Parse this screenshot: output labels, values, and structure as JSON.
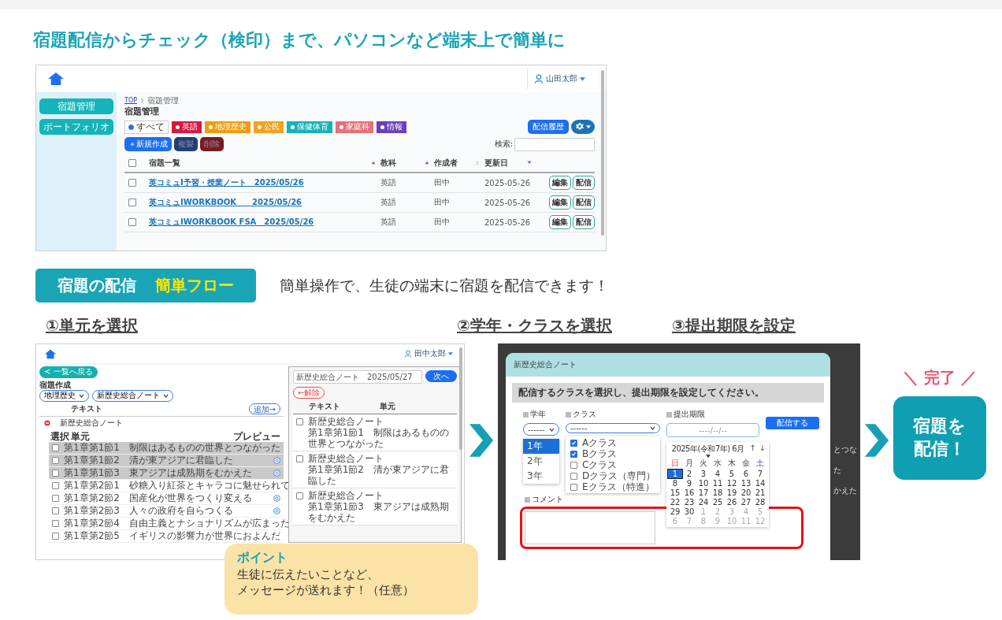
{
  "headline": "宿題配信からチェック（検印）まで、パソコンなど端末上で簡単に",
  "manage": {
    "user": "山田太郎",
    "sidebar": [
      "宿題管理",
      "ポートフォリオ"
    ],
    "breadcrumb": [
      "TOP",
      "宿題管理"
    ],
    "title": "宿題管理",
    "filters": [
      {
        "label": "すべて",
        "kind": "radio",
        "selected": true
      },
      {
        "label": "英語",
        "kind": "tag",
        "color": "#d7173f"
      },
      {
        "label": "地理歴史",
        "kind": "tag",
        "color": "#ef9d0c"
      },
      {
        "label": "公民",
        "kind": "tag",
        "color": "#f3a21c"
      },
      {
        "label": "保健体育",
        "kind": "tag",
        "color": "#17b2b8"
      },
      {
        "label": "家庭科",
        "kind": "tag",
        "color": "#e8707a"
      },
      {
        "label": "情報",
        "kind": "tag",
        "color": "#6c3fbf"
      }
    ],
    "actions": [
      {
        "label": "＋新規作成",
        "kind": "primary",
        "disabled": false
      },
      {
        "label": "複製",
        "kind": "copy",
        "disabled": true
      },
      {
        "label": "削除",
        "kind": "delete",
        "disabled": true
      }
    ],
    "history_button": "配信履歴",
    "search_label": "検索:",
    "select_all_checked": false,
    "columns": [
      {
        "label": "宿題一覧",
        "sorted": true,
        "descending": false
      },
      {
        "label": "教科",
        "sorted": true,
        "descending": false
      },
      {
        "label": "作成者",
        "sorted": false
      },
      {
        "label": "更新日",
        "sorted": true,
        "descending": true
      }
    ],
    "rows": [
      {
        "title": "英コミュⅠ予習・授業ノート　2025/05/26",
        "subject": "英語",
        "author": "田中",
        "updated": "2025-05-26",
        "checked": false,
        "buttons": [
          "編集",
          "配信"
        ]
      },
      {
        "title": "英コミュⅠWORKBOOK　　2025/05/26",
        "subject": "英語",
        "author": "田中",
        "updated": "2025-05-26",
        "checked": false,
        "buttons": [
          "編集",
          "配信"
        ]
      },
      {
        "title": "英コミュⅠWORKBOOK FSA　2025/05/26",
        "subject": "英語",
        "author": "田中",
        "updated": "2025-05-26",
        "checked": false,
        "buttons": [
          "編集",
          "配信"
        ]
      }
    ]
  },
  "banner": {
    "title": "宿題の配信",
    "highlight": "簡単フロー",
    "caption": "簡単操作で、生徒の端末に宿題を配信できます！"
  },
  "steps": [
    "①単元を選択",
    "②学年・クラスを選択",
    "③提出期限を設定"
  ],
  "unit_screen": {
    "user": "田中太郎",
    "back_button": "< 一覧へ戻る",
    "title": "宿題作成",
    "selects": [
      "地理歴史",
      "新歴史総合ノート"
    ],
    "list_label": "テキスト",
    "add_button": "追加→",
    "group": "新歴史総合ノート",
    "columns": [
      "選択",
      "単元",
      "プレビュー"
    ],
    "units": [
      {
        "name": "第1章第1節1　制限はあるものの世界とつながった",
        "selected": true
      },
      {
        "name": "第1章第1節2　清が東アジアに君臨した",
        "selected": true
      },
      {
        "name": "第1章第1節3　東アジアは成熟期をむかえた",
        "selected": true
      },
      {
        "name": "第1章第2節1　砂糖入り紅茶とキャラコに魅せられて",
        "selected": false
      },
      {
        "name": "第1章第2節2　国産化が世界をつくり変える",
        "selected": false
      },
      {
        "name": "第1章第2節3　人々の政府を自らつくる",
        "selected": false
      },
      {
        "name": "第1章第2節4　自由主義とナショナリズムが広まった",
        "selected": false
      },
      {
        "name": "第1章第2節5　イギリスの影響力が世界におよんだ",
        "selected": false
      }
    ],
    "panel": {
      "name_value": "新歴史総合ノート　2025/05/27",
      "next_button": "次へ",
      "release_button": "←解除",
      "columns": [
        "テキスト",
        "単元"
      ],
      "rows": [
        {
          "text": "新歴史総合ノート",
          "unit": "第1章第1節1　制限はあるものの世界とつながった",
          "checked": false
        },
        {
          "text": "新歴史総合ノート",
          "unit": "第1章第1節2　清が東アジアに君臨した",
          "checked": false
        },
        {
          "text": "新歴史総合ノート",
          "unit": "第1章第1節3　東アジアは成熟期をむかえた",
          "checked": false
        }
      ]
    }
  },
  "deliver_screen": {
    "title": "新歴史総合ノート",
    "instruction": "配信するクラスを選択し、提出期限を設定してください。",
    "grade_label": "学年",
    "grade_select": "------",
    "grades": [
      {
        "label": "1年",
        "selected": true
      },
      {
        "label": "2年",
        "selected": false
      },
      {
        "label": "3年",
        "selected": false
      }
    ],
    "class_label": "クラス",
    "class_select": "------",
    "classes": [
      {
        "label": "Aクラス",
        "checked": true
      },
      {
        "label": "Bクラス",
        "checked": true
      },
      {
        "label": "Cクラス",
        "checked": false
      },
      {
        "label": "Dクラス（専門）",
        "checked": false
      },
      {
        "label": "Eクラス（特進）",
        "checked": false
      }
    ],
    "due_label": "提出期限",
    "due_placeholder": "----/--/--",
    "calendar": {
      "month": "2025年(令和7年) 6月",
      "up": "↑",
      "down": "↓",
      "weekdays": [
        "日",
        "月",
        "火",
        "水",
        "木",
        "金",
        "土"
      ],
      "weeks": [
        {
          "days": [
            {
              "d": "1",
              "muted": false,
              "selected": true
            },
            {
              "d": "2",
              "muted": false,
              "selected": false
            },
            {
              "d": "3",
              "muted": false,
              "selected": false
            },
            {
              "d": "4",
              "muted": false,
              "selected": false
            },
            {
              "d": "5",
              "muted": false,
              "selected": false
            },
            {
              "d": "6",
              "muted": false,
              "selected": false
            },
            {
              "d": "7",
              "muted": false,
              "selected": false
            }
          ]
        },
        {
          "days": [
            {
              "d": "8",
              "muted": false,
              "selected": false
            },
            {
              "d": "9",
              "muted": false,
              "selected": false
            },
            {
              "d": "10",
              "muted": false,
              "selected": false
            },
            {
              "d": "11",
              "muted": false,
              "selected": false
            },
            {
              "d": "12",
              "muted": false,
              "selected": false
            },
            {
              "d": "13",
              "muted": false,
              "selected": false
            },
            {
              "d": "14",
              "muted": false,
              "selected": false
            }
          ]
        },
        {
          "days": [
            {
              "d": "15",
              "muted": false,
              "selected": false
            },
            {
              "d": "16",
              "muted": false,
              "selected": false
            },
            {
              "d": "17",
              "muted": false,
              "selected": false
            },
            {
              "d": "18",
              "muted": false,
              "selected": false
            },
            {
              "d": "19",
              "muted": false,
              "selected": false
            },
            {
              "d": "20",
              "muted": false,
              "selected": false
            },
            {
              "d": "21",
              "muted": false,
              "selected": false
            }
          ]
        },
        {
          "days": [
            {
              "d": "22",
              "muted": false,
              "selected": false
            },
            {
              "d": "23",
              "muted": false,
              "selected": false
            },
            {
              "d": "24",
              "muted": false,
              "selected": false
            },
            {
              "d": "25",
              "muted": false,
              "selected": false
            },
            {
              "d": "26",
              "muted": false,
              "selected": false
            },
            {
              "d": "27",
              "muted": false,
              "selected": false
            },
            {
              "d": "28",
              "muted": false,
              "selected": false
            }
          ]
        },
        {
          "days": [
            {
              "d": "29",
              "muted": false,
              "selected": false
            },
            {
              "d": "30",
              "muted": false,
              "selected": false
            },
            {
              "d": "1",
              "muted": true,
              "selected": false
            },
            {
              "d": "2",
              "muted": true,
              "selected": false
            },
            {
              "d": "3",
              "muted": true,
              "selected": false
            },
            {
              "d": "4",
              "muted": true,
              "selected": false
            },
            {
              "d": "5",
              "muted": true,
              "selected": false
            }
          ]
        },
        {
          "days": [
            {
              "d": "6",
              "muted": true,
              "selected": false
            },
            {
              "d": "7",
              "muted": true,
              "selected": false
            },
            {
              "d": "8",
              "muted": true,
              "selected": false
            },
            {
              "d": "9",
              "muted": true,
              "selected": false
            },
            {
              "d": "10",
              "muted": true,
              "selected": false
            },
            {
              "d": "11",
              "muted": true,
              "selected": false
            },
            {
              "d": "12",
              "muted": true,
              "selected": false
            }
          ]
        }
      ]
    },
    "submit_button": "配信する",
    "comment_label": "コメント",
    "background_fragments": [
      "とつな",
      "た",
      "かえた"
    ]
  },
  "done": {
    "mark": "＼ 完了 ／",
    "button": "宿題を配信！"
  },
  "callout": {
    "title": "ポイント",
    "lines": [
      "生徒に伝えたいことなど、",
      "メッセージが送れます！（任意）"
    ]
  }
}
